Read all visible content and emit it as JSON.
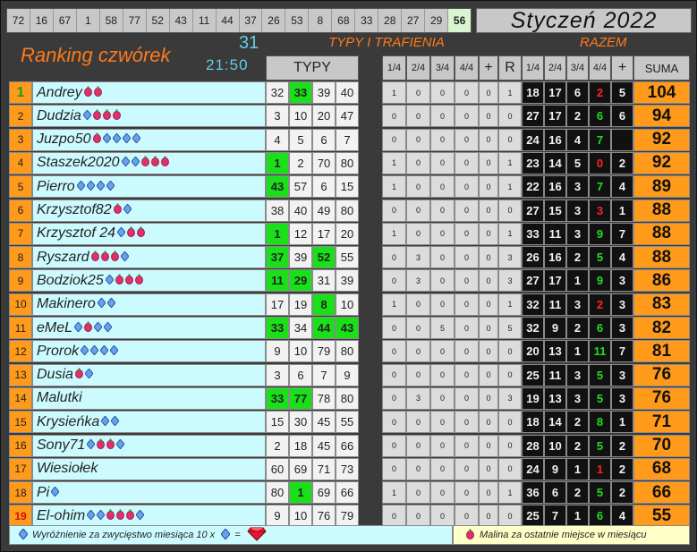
{
  "top_numbers": [
    "72",
    "16",
    "67",
    "1",
    "58",
    "77",
    "52",
    "43",
    "11",
    "44",
    "37",
    "26",
    "53",
    "8",
    "68",
    "33",
    "28",
    "27",
    "29",
    "56"
  ],
  "month_title": "Styczeń 2022",
  "ranking_title": "Ranking czwórek",
  "day_number": "31",
  "clock": "21:50",
  "section_typy": "TYPY I TRAFIENIA",
  "section_razem": "RAZEM",
  "headers": {
    "typy": "TYPY",
    "q1": "1/4",
    "q2": "2/4",
    "q3": "3/4",
    "q4": "4/4",
    "plus": "+",
    "r": "R",
    "suma": "SUMA"
  },
  "colors": {
    "rank_bg": "#ff9a1a",
    "name_bg": "#ccfbff",
    "hit": "#19e019",
    "accent_orange": "#ff7a1a",
    "accent_cyan": "#5fd0e8"
  },
  "rows": [
    {
      "rank": "1",
      "name": "Andrey",
      "marks": "mm",
      "tips": [
        "32",
        "33",
        "39",
        "40"
      ],
      "hits": [
        1
      ],
      "mini": [
        "1",
        "0",
        "0",
        "0",
        "0",
        "1"
      ],
      "tot": [
        "18",
        "17",
        "6",
        "2"
      ],
      "totc": [
        "w",
        "w",
        "w",
        "r"
      ],
      "plus": "5",
      "suma": "104"
    },
    {
      "rank": "2",
      "name": "Dudzia",
      "marks": "dmmm",
      "tips": [
        "3",
        "10",
        "20",
        "47"
      ],
      "hits": [],
      "mini": [
        "0",
        "0",
        "0",
        "0",
        "0",
        "0"
      ],
      "tot": [
        "27",
        "17",
        "2",
        "6"
      ],
      "totc": [
        "w",
        "w",
        "w",
        "g"
      ],
      "plus": "6",
      "suma": "94"
    },
    {
      "rank": "3",
      "name": "Juzpo50",
      "marks": "mdddd",
      "tips": [
        "4",
        "5",
        "6",
        "7"
      ],
      "hits": [],
      "mini": [
        "0",
        "0",
        "0",
        "0",
        "0",
        "0"
      ],
      "tot": [
        "24",
        "16",
        "4",
        "7"
      ],
      "totc": [
        "w",
        "w",
        "w",
        "g"
      ],
      "plus": "",
      "suma": "92"
    },
    {
      "rank": "4",
      "name": "Staszek2020",
      "marks": "ddmmm",
      "tips": [
        "1",
        "2",
        "70",
        "80"
      ],
      "hits": [
        0
      ],
      "mini": [
        "1",
        "0",
        "0",
        "0",
        "0",
        "1"
      ],
      "tot": [
        "23",
        "14",
        "5",
        "0"
      ],
      "totc": [
        "w",
        "w",
        "w",
        "r"
      ],
      "plus": "2",
      "suma": "92"
    },
    {
      "rank": "5",
      "name": "Pierro",
      "marks": "dddd",
      "tips": [
        "43",
        "57",
        "6",
        "15"
      ],
      "hits": [
        0
      ],
      "mini": [
        "1",
        "0",
        "0",
        "0",
        "0",
        "1"
      ],
      "tot": [
        "22",
        "16",
        "3",
        "7"
      ],
      "totc": [
        "w",
        "w",
        "w",
        "g"
      ],
      "plus": "4",
      "suma": "89"
    },
    {
      "rank": "6",
      "name": "Krzysztof82",
      "marks": "md",
      "tips": [
        "38",
        "40",
        "49",
        "80"
      ],
      "hits": [],
      "mini": [
        "0",
        "0",
        "0",
        "0",
        "0",
        "0"
      ],
      "tot": [
        "27",
        "15",
        "3",
        "3"
      ],
      "totc": [
        "w",
        "w",
        "w",
        "r"
      ],
      "plus": "1",
      "suma": "88"
    },
    {
      "rank": "7",
      "name": "Krzysztof 24",
      "marks": "dmm",
      "tips": [
        "1",
        "12",
        "17",
        "20"
      ],
      "hits": [
        0
      ],
      "mini": [
        "1",
        "0",
        "0",
        "0",
        "0",
        "1"
      ],
      "tot": [
        "33",
        "11",
        "3",
        "9"
      ],
      "totc": [
        "w",
        "w",
        "w",
        "g"
      ],
      "plus": "7",
      "suma": "88"
    },
    {
      "rank": "8",
      "name": "Ryszard",
      "marks": "mmmd",
      "tips": [
        "37",
        "39",
        "52",
        "55"
      ],
      "hits": [
        0,
        2
      ],
      "mini": [
        "0",
        "3",
        "0",
        "0",
        "0",
        "3"
      ],
      "tot": [
        "26",
        "16",
        "2",
        "5"
      ],
      "totc": [
        "w",
        "w",
        "w",
        "g"
      ],
      "plus": "4",
      "suma": "88"
    },
    {
      "rank": "9",
      "name": "Bodziok25",
      "marks": "dmmm",
      "tips": [
        "11",
        "29",
        "31",
        "39"
      ],
      "hits": [
        0,
        1
      ],
      "mini": [
        "0",
        "3",
        "0",
        "0",
        "0",
        "3"
      ],
      "tot": [
        "27",
        "17",
        "1",
        "9"
      ],
      "totc": [
        "w",
        "w",
        "w",
        "g"
      ],
      "plus": "3",
      "suma": "86"
    },
    {
      "rank": "10",
      "name": "Makinero",
      "marks": "dd",
      "tips": [
        "17",
        "19",
        "8",
        "10"
      ],
      "hits": [
        2
      ],
      "mini": [
        "1",
        "0",
        "0",
        "0",
        "0",
        "1"
      ],
      "tot": [
        "32",
        "11",
        "3",
        "2"
      ],
      "totc": [
        "w",
        "w",
        "w",
        "r"
      ],
      "plus": "3",
      "suma": "83"
    },
    {
      "rank": "11",
      "name": "eMeL",
      "marks": "dmdd",
      "tips": [
        "33",
        "34",
        "44",
        "43"
      ],
      "hits": [
        0,
        2,
        3
      ],
      "mini": [
        "0",
        "0",
        "5",
        "0",
        "0",
        "5"
      ],
      "tot": [
        "32",
        "9",
        "2",
        "6"
      ],
      "totc": [
        "w",
        "w",
        "w",
        "g"
      ],
      "plus": "3",
      "suma": "82"
    },
    {
      "rank": "12",
      "name": "Prorok",
      "marks": "dddd",
      "tips": [
        "9",
        "10",
        "79",
        "80"
      ],
      "hits": [],
      "mini": [
        "0",
        "0",
        "0",
        "0",
        "0",
        "0"
      ],
      "tot": [
        "20",
        "13",
        "1",
        "11"
      ],
      "totc": [
        "w",
        "w",
        "w",
        "g"
      ],
      "plus": "7",
      "suma": "81"
    },
    {
      "rank": "13",
      "name": "Dusia",
      "marks": "md",
      "tips": [
        "3",
        "6",
        "7",
        "9"
      ],
      "hits": [],
      "mini": [
        "0",
        "0",
        "0",
        "0",
        "0",
        "0"
      ],
      "tot": [
        "25",
        "11",
        "3",
        "5"
      ],
      "totc": [
        "w",
        "w",
        "w",
        "g"
      ],
      "plus": "3",
      "suma": "76"
    },
    {
      "rank": "14",
      "name": "Malutki",
      "marks": "",
      "tips": [
        "33",
        "77",
        "78",
        "80"
      ],
      "hits": [
        0,
        1
      ],
      "mini": [
        "0",
        "3",
        "0",
        "0",
        "0",
        "3"
      ],
      "tot": [
        "19",
        "13",
        "3",
        "5"
      ],
      "totc": [
        "w",
        "w",
        "w",
        "g"
      ],
      "plus": "3",
      "suma": "76"
    },
    {
      "rank": "15",
      "name": "Krysieńka",
      "marks": "dd",
      "tips": [
        "15",
        "30",
        "45",
        "55"
      ],
      "hits": [],
      "mini": [
        "0",
        "0",
        "0",
        "0",
        "0",
        "0"
      ],
      "tot": [
        "18",
        "14",
        "2",
        "8"
      ],
      "totc": [
        "w",
        "w",
        "w",
        "g"
      ],
      "plus": "1",
      "suma": "71"
    },
    {
      "rank": "16",
      "name": "Sony71",
      "marks": "dmmd",
      "tips": [
        "2",
        "18",
        "45",
        "66"
      ],
      "hits": [],
      "mini": [
        "0",
        "0",
        "0",
        "0",
        "0",
        "0"
      ],
      "tot": [
        "28",
        "10",
        "2",
        "5"
      ],
      "totc": [
        "w",
        "w",
        "w",
        "g"
      ],
      "plus": "2",
      "suma": "70"
    },
    {
      "rank": "17",
      "name": "Wiesiołek",
      "marks": "",
      "tips": [
        "60",
        "69",
        "71",
        "73"
      ],
      "hits": [],
      "mini": [
        "0",
        "0",
        "0",
        "0",
        "0",
        "0"
      ],
      "tot": [
        "24",
        "9",
        "1",
        "1"
      ],
      "totc": [
        "w",
        "w",
        "w",
        "r"
      ],
      "plus": "2",
      "suma": "68"
    },
    {
      "rank": "18",
      "name": "Pi",
      "marks": "d",
      "tips": [
        "80",
        "1",
        "69",
        "66"
      ],
      "hits": [
        1
      ],
      "mini": [
        "1",
        "0",
        "0",
        "0",
        "0",
        "1"
      ],
      "tot": [
        "36",
        "6",
        "2",
        "5"
      ],
      "totc": [
        "w",
        "w",
        "w",
        "g"
      ],
      "plus": "2",
      "suma": "66"
    },
    {
      "rank": "19",
      "name": "El-ohim",
      "marks": "ddmmmd",
      "tips": [
        "9",
        "10",
        "76",
        "79"
      ],
      "hits": [],
      "mini": [
        "0",
        "0",
        "0",
        "0",
        "0",
        "0"
      ],
      "tot": [
        "25",
        "7",
        "1",
        "6"
      ],
      "totc": [
        "w",
        "w",
        "w",
        "g"
      ],
      "plus": "4",
      "suma": "55"
    }
  ],
  "footer": {
    "left_text": "Wyróżnienie za zwycięstwo miesiąca  10 x",
    "equals": "=",
    "right_text": "Malina za ostatnie miejsce w miesiącu"
  }
}
